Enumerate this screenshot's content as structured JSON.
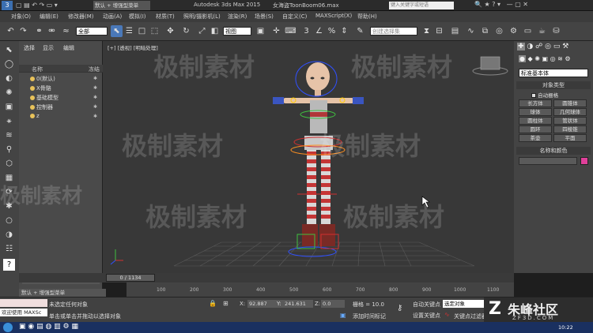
{
  "titlebar": {
    "tabs": [
      "默认 + 增强型菜单",
      "Autodesk 3ds Max 2015",
      "女海盗ToonBoom06.max"
    ],
    "search_placeholder": "键入关键字或短语"
  },
  "menus": [
    "对象(O)",
    "编辑(E)",
    "修改器(M)",
    "动画(A)",
    "模拟(I)",
    "材质(T)",
    "照明/摄影机(L)",
    "渲染(R)",
    "场景(S)",
    "自定义(C)",
    "MAXScript(X)",
    "帮助(H)"
  ],
  "toolbar": {
    "selection_filter": "全部",
    "ref_coord": "视图",
    "named_selection": "创建选择集"
  },
  "scene_explorer": {
    "tabs": [
      "选择",
      "显示",
      "编辑"
    ],
    "col_name": "名称",
    "col_freeze": "冻结",
    "items": [
      "0(默认)",
      "X骨骼",
      "基础模型",
      "控制器",
      "z"
    ]
  },
  "viewport": {
    "label": "[+] [透视] [明暗处理]"
  },
  "command_panel": {
    "dropdown": "标准基本体",
    "rollout_object_type": "对象类型",
    "autogrid": "自动栅格",
    "buttons": [
      "长方体",
      "圆锥体",
      "球体",
      "几何球体",
      "圆柱体",
      "管状体",
      "圆环",
      "四棱锥",
      "茶壶",
      "平面"
    ],
    "rollout_name_color": "名称和颜色",
    "color": "#e0409a"
  },
  "timeline": {
    "frame_counter": "0 / 1134",
    "ticks": [
      "100",
      "200",
      "300",
      "400",
      "500",
      "600",
      "700",
      "800",
      "900",
      "1000",
      "1100"
    ]
  },
  "status": {
    "workspace": "默认 + 增强型菜单",
    "maxscript": "欢迎使用 MAXSc",
    "prompt1": "未选定任何对象",
    "prompt2": "单击或单击并拖动以选择对象",
    "x_label": "X:",
    "x_value": "92.887",
    "y_label": "Y:",
    "y_value": "241.631",
    "z_label": "Z:",
    "z_value": "0.0",
    "grid": "栅格 = 10.0",
    "add_time_tag": "添加时间标记",
    "auto_key": "自动关键点",
    "set_key": "设置关键点",
    "key_filter_dropdown": "选定对象",
    "key_filters": "关键点过滤器"
  },
  "taskbar": {
    "clock": "10:22"
  },
  "brand": {
    "logo_text": "朱峰社区",
    "logo_url": "ZF3D.COM"
  },
  "watermark": "极制素材"
}
